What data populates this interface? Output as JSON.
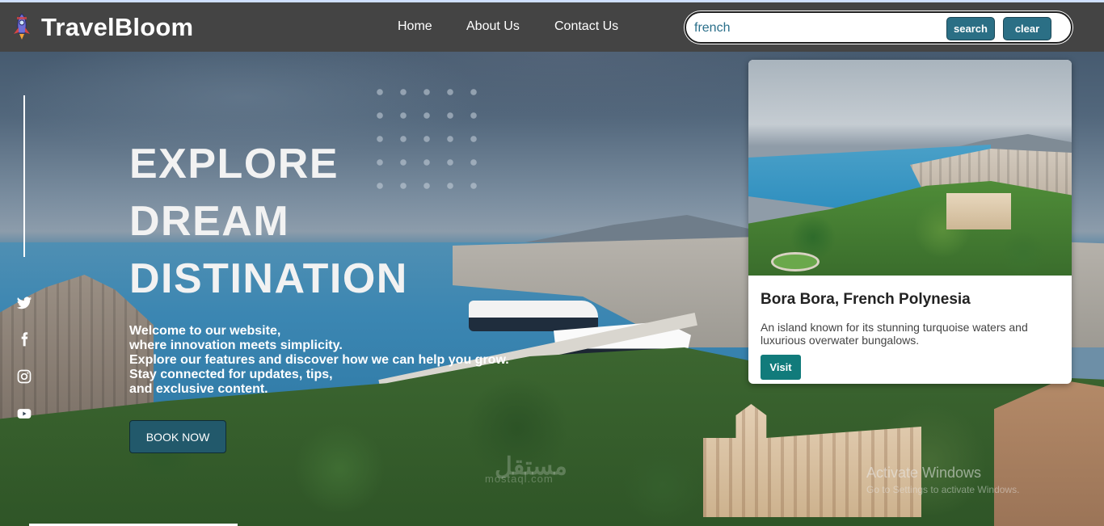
{
  "brand": {
    "name": "TravelBloom",
    "logo_icon": "rocket-icon"
  },
  "nav": {
    "links": [
      {
        "label": "Home"
      },
      {
        "label": "About Us"
      },
      {
        "label": "Contact Us"
      }
    ]
  },
  "search": {
    "value": "french",
    "search_label": "search",
    "clear_label": "clear"
  },
  "social": [
    "twitter-icon",
    "facebook-icon",
    "instagram-icon",
    "youtube-icon"
  ],
  "hero": {
    "title_lines": [
      "EXPLORE",
      "DREAM",
      "DISTINATION"
    ],
    "subtitle_lines": [
      "Welcome to our website,",
      "where innovation meets simplicity.",
      "Explore our features and discover how we can help you grow.",
      "Stay connected for updates, tips,",
      "and exclusive content."
    ],
    "cta_label": "BOOK NOW"
  },
  "result_card": {
    "title": "Bora Bora, French Polynesia",
    "description": "An island known for its stunning turquoise waters and luxurious overwater bungalows.",
    "button_label": "Visit"
  },
  "watermarks": {
    "activate_title": "Activate Windows",
    "activate_sub": "Go to Settings to activate Windows.",
    "mostaql_ar": "مستقل",
    "mostaql": "mostaql.com"
  },
  "colors": {
    "navbar": "#444444",
    "accent_button": "#2b6f85",
    "book_button": "#22596b",
    "visit_button": "#117b7b"
  }
}
